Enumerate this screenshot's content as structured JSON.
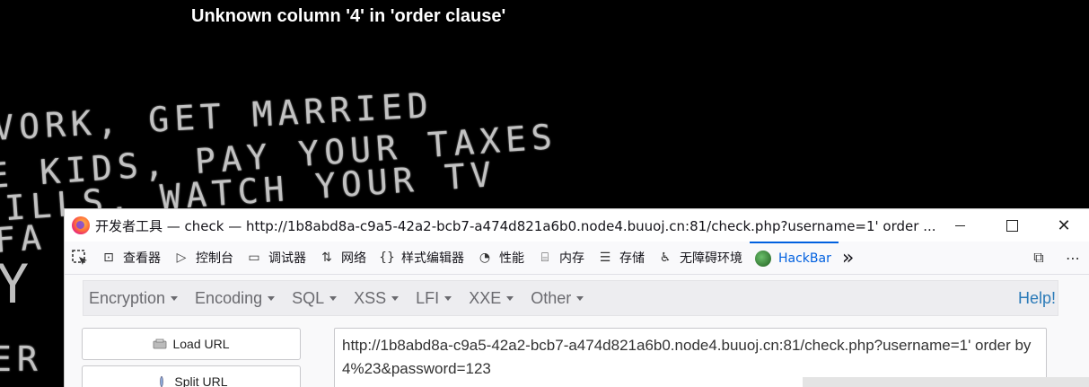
{
  "page": {
    "error_message": "Unknown column '4' in 'order clause'"
  },
  "background_text": {
    "line1": "VORK, GET MARRIED",
    "line2": "E KIDS, PAY YOUR TAXES",
    "line3": "BILLS, WATCH YOUR TV",
    "line4": "FA",
    "line5": "Y",
    "line6": "ER"
  },
  "window": {
    "title": "开发者工具 — check — http://1b8abd8a-c9a5-42a2-bcb7-a474d821a6b0.node4.buuoj.cn:81/check.php?username=1' order ...",
    "minimize_icon": "minimize-icon",
    "maximize_icon": "maximize-icon",
    "close_icon": "close-icon",
    "close_glyph": "✕"
  },
  "devtools_tabs": [
    {
      "label": "查看器",
      "icon": "inspector-icon",
      "glyph": "⊡"
    },
    {
      "label": "控制台",
      "icon": "console-icon",
      "glyph": "▷"
    },
    {
      "label": "调试器",
      "icon": "debugger-icon",
      "glyph": "▭"
    },
    {
      "label": "网络",
      "icon": "network-icon",
      "glyph": "⇅"
    },
    {
      "label": "样式编辑器",
      "icon": "style-editor-icon",
      "glyph": "{}"
    },
    {
      "label": "性能",
      "icon": "performance-icon",
      "glyph": "◔"
    },
    {
      "label": "内存",
      "icon": "memory-icon",
      "glyph": "⌸"
    },
    {
      "label": "存储",
      "icon": "storage-icon",
      "glyph": "☰"
    },
    {
      "label": "无障碍环境",
      "icon": "accessibility-icon",
      "glyph": "♿"
    },
    {
      "label": "HackBar",
      "icon": "hackbar-icon",
      "glyph": ""
    }
  ],
  "toolbar_right": {
    "overflow_glyph": "»",
    "dock_glyph": "⧉",
    "menu_glyph": "⋯"
  },
  "hackbar": {
    "menu": [
      "Encryption",
      "Encoding",
      "SQL",
      "XSS",
      "LFI",
      "XXE",
      "Other"
    ],
    "help": "Help!",
    "load_url": "Load URL",
    "split_url": "Split URL",
    "url_value": "http://1b8abd8a-c9a5-42a2-bcb7-a474d821a6b0.node4.buuoj.cn:81/check.php?username=1' order by 4%23&password=123"
  },
  "colors": {
    "active_tab": "#0060df",
    "help_link": "#2a7ab8",
    "background": "#000000"
  }
}
